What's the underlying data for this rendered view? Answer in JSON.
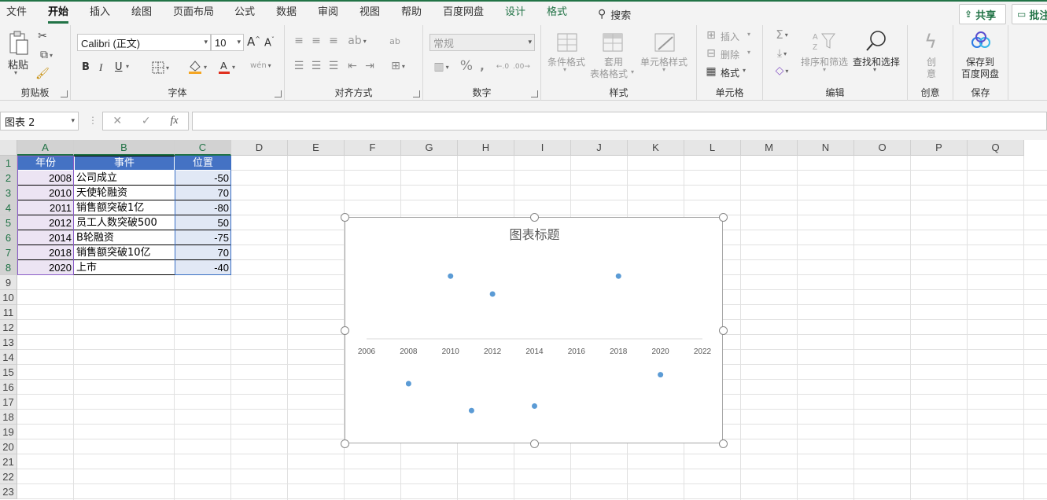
{
  "menu": {
    "tabs": [
      "文件",
      "开始",
      "插入",
      "绘图",
      "页面布局",
      "公式",
      "数据",
      "审阅",
      "视图",
      "帮助",
      "百度网盘",
      "设计",
      "格式"
    ],
    "search": "搜索",
    "share": "共享",
    "comment": "批注"
  },
  "ribbon": {
    "clipboard": {
      "paste": "粘贴",
      "label": "剪贴板"
    },
    "font": {
      "name": "Calibri (正文)",
      "size": "10",
      "bold": "B",
      "italic": "I",
      "underline": "U",
      "label": "字体"
    },
    "alignment": {
      "label": "对齐方式"
    },
    "number": {
      "format": "常规",
      "label": "数字"
    },
    "styles": {
      "conditional": "条件格式",
      "table_line1": "套用",
      "table_line2": "表格格式",
      "cell_styles": "单元格样式",
      "label": "样式"
    },
    "cells": {
      "insert": "插入",
      "delete": "删除",
      "format": "格式",
      "label": "单元格"
    },
    "editing": {
      "sort": "排序和筛选",
      "find": "查找和选择",
      "label": "编辑"
    },
    "creative": {
      "btn_line1": "创",
      "btn_line2": "意",
      "label": "创意"
    },
    "save": {
      "line1": "保存到",
      "line2": "百度网盘",
      "label": "保存"
    }
  },
  "formula_bar": {
    "name_box": "图表 2",
    "fx": "fx",
    "value": ""
  },
  "grid": {
    "columns": [
      "A",
      "B",
      "C",
      "D",
      "E",
      "F",
      "G",
      "H",
      "I",
      "J",
      "K",
      "L",
      "M",
      "N",
      "O",
      "P",
      "Q"
    ],
    "rows": [
      "1",
      "2",
      "3",
      "4",
      "5",
      "6",
      "7",
      "8",
      "9",
      "10",
      "11",
      "12",
      "13",
      "14",
      "15",
      "16",
      "17",
      "18",
      "19",
      "20",
      "21",
      "22",
      "23"
    ],
    "selected_columns": [
      "A",
      "B",
      "C"
    ],
    "selected_rows": [
      "1",
      "2",
      "3",
      "4",
      "5",
      "6",
      "7",
      "8"
    ],
    "table": {
      "headers": [
        "年份",
        "事件",
        "位置"
      ],
      "rows": [
        [
          "2008",
          "公司成立",
          "-50"
        ],
        [
          "2010",
          "天使轮融资",
          "70"
        ],
        [
          "2011",
          "销售额突破1亿",
          "-80"
        ],
        [
          "2012",
          "员工人数突破500",
          "50"
        ],
        [
          "2014",
          "B轮融资",
          "-75"
        ],
        [
          "2018",
          "销售额突破10亿",
          "70"
        ],
        [
          "2020",
          "上市",
          "-40"
        ]
      ]
    }
  },
  "chart_data": {
    "type": "scatter",
    "title": "图表标题",
    "x": [
      2008,
      2010,
      2011,
      2012,
      2014,
      2018,
      2020
    ],
    "y": [
      -50,
      70,
      -80,
      50,
      -75,
      70,
      -40
    ],
    "xlim": [
      2006,
      2022
    ],
    "ylim": [
      -100,
      100
    ],
    "x_ticks": [
      "2006",
      "2008",
      "2010",
      "2012",
      "2014",
      "2016",
      "2018",
      "2020",
      "2022"
    ],
    "point_color": "#5b9bd5",
    "axis_color": "#d9d9d9",
    "gridlines": false,
    "legend": "none"
  },
  "colors": {
    "accent": "#217346",
    "header_fill": "#4472c4",
    "col_a_fill": "#ece4f3",
    "col_c_fill": "#e1e8f5"
  }
}
